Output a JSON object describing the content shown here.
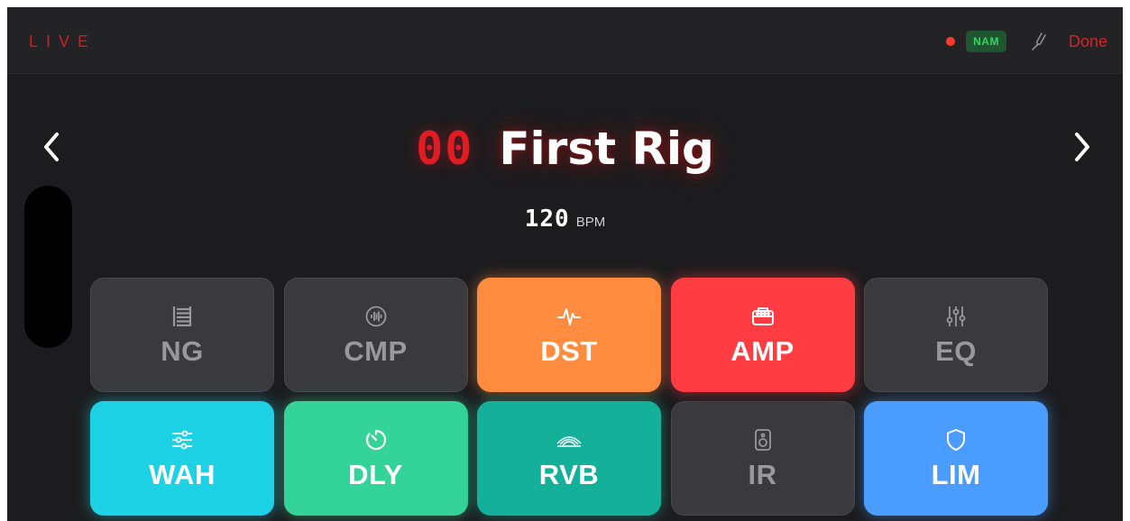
{
  "header": {
    "mode_label": "LIVE",
    "nam_badge": "NAM",
    "done_label": "Done"
  },
  "rig": {
    "number": "00",
    "name": "First Rig",
    "bpm_value": "120",
    "bpm_unit": "BPM"
  },
  "blocks": [
    {
      "label": "NG",
      "icon": "noise-gate-icon",
      "active": false
    },
    {
      "label": "CMP",
      "icon": "compressor-icon",
      "active": false
    },
    {
      "label": "DST",
      "icon": "waveform-icon",
      "active": true,
      "color": "#ff8c3f"
    },
    {
      "label": "AMP",
      "icon": "amp-icon",
      "active": true,
      "color": "#ff3c42"
    },
    {
      "label": "EQ",
      "icon": "eq-sliders-icon",
      "active": false
    },
    {
      "label": "WAH",
      "icon": "wah-sliders-icon",
      "active": true,
      "color": "#1ed2e6"
    },
    {
      "label": "DLY",
      "icon": "timer-icon",
      "active": true,
      "color": "#34d399"
    },
    {
      "label": "RVB",
      "icon": "reverb-wave-icon",
      "active": true,
      "color": "#14b09a"
    },
    {
      "label": "IR",
      "icon": "speaker-icon",
      "active": false
    },
    {
      "label": "LIM",
      "icon": "shield-icon",
      "active": true,
      "color": "#4a9cff"
    }
  ],
  "colors": {
    "accent_red": "#e01b24",
    "background": "#1c1c1e",
    "block_off": "#3a3a3c"
  }
}
